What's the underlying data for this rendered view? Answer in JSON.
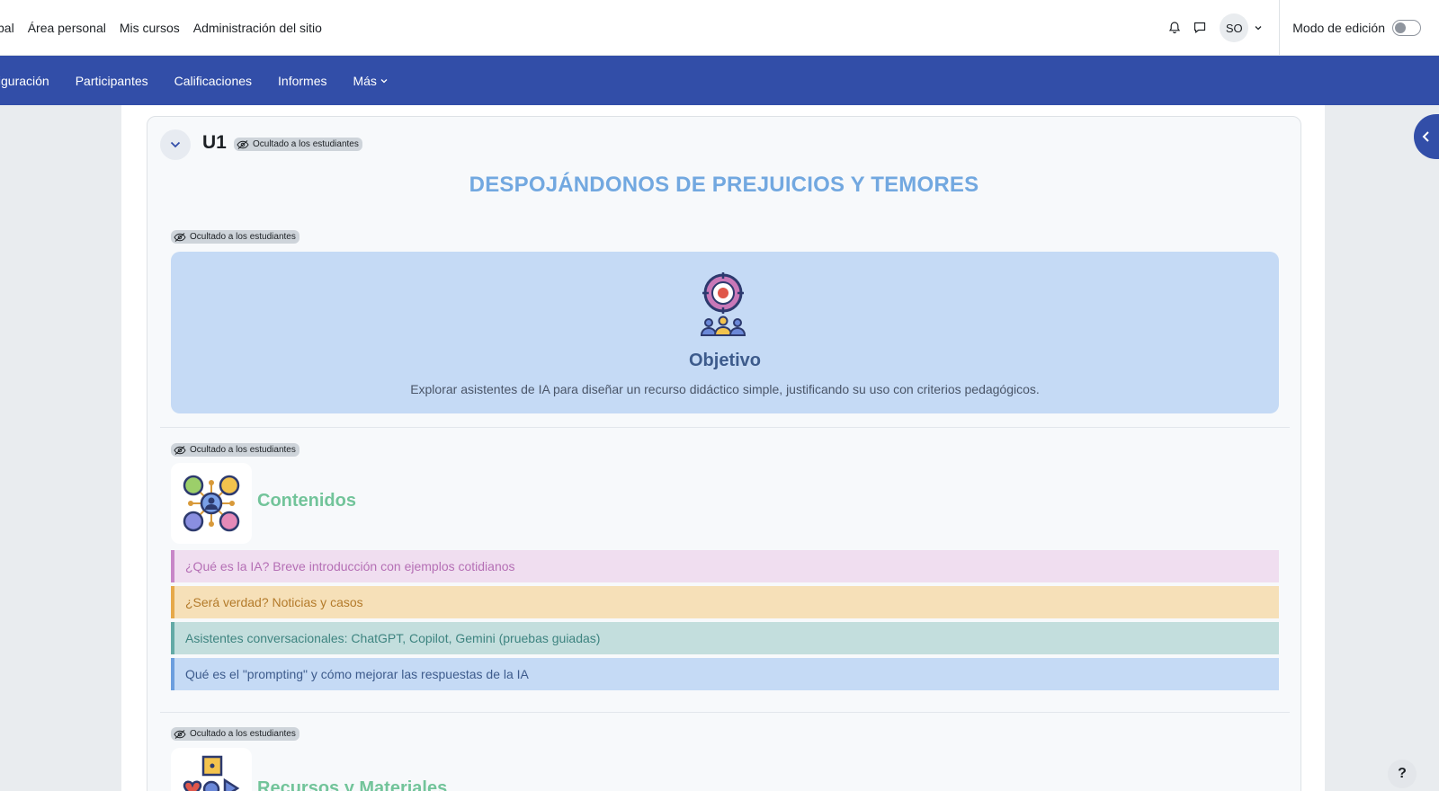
{
  "topnav": {
    "items": [
      "pal",
      "Área personal",
      "Mis cursos",
      "Administración del sitio"
    ],
    "avatar_initials": "SO",
    "edit_mode_label": "Modo de edición"
  },
  "secnav": {
    "items": [
      "figuración",
      "Participantes",
      "Calificaciones",
      "Informes",
      "Más"
    ]
  },
  "section": {
    "title": "U1",
    "hidden_badge": "Ocultado a los estudiantes",
    "heading": "DESPOJÁNDONOS DE PREJUICIOS Y TEMORES"
  },
  "objective": {
    "badge": "Ocultado a los estudiantes",
    "title": "Objetivo",
    "description": "Explorar asistentes de IA para diseñar un recurso didáctico simple, justificando su uso con criterios pedagógicos."
  },
  "contents": {
    "badge": "Ocultado a los estudiantes",
    "title": "Contenidos",
    "items": [
      "¿Qué es la IA? Breve introducción con ejemplos cotidianos",
      "¿Será verdad? Noticias y casos",
      "Asistentes conversacionales: ChatGPT, Copilot, Gemini (pruebas guiadas)",
      "Qué es el \"prompting\" y cómo mejorar las respuestas de la IA"
    ]
  },
  "resources": {
    "badge": "Ocultado a los estudiantes",
    "title": "Recursos y Materiales"
  },
  "help": {
    "label": "?"
  },
  "colors": {
    "primary_nav": "#324ea8",
    "heading_blue": "#72a8e0",
    "green_title": "#72c49a"
  }
}
